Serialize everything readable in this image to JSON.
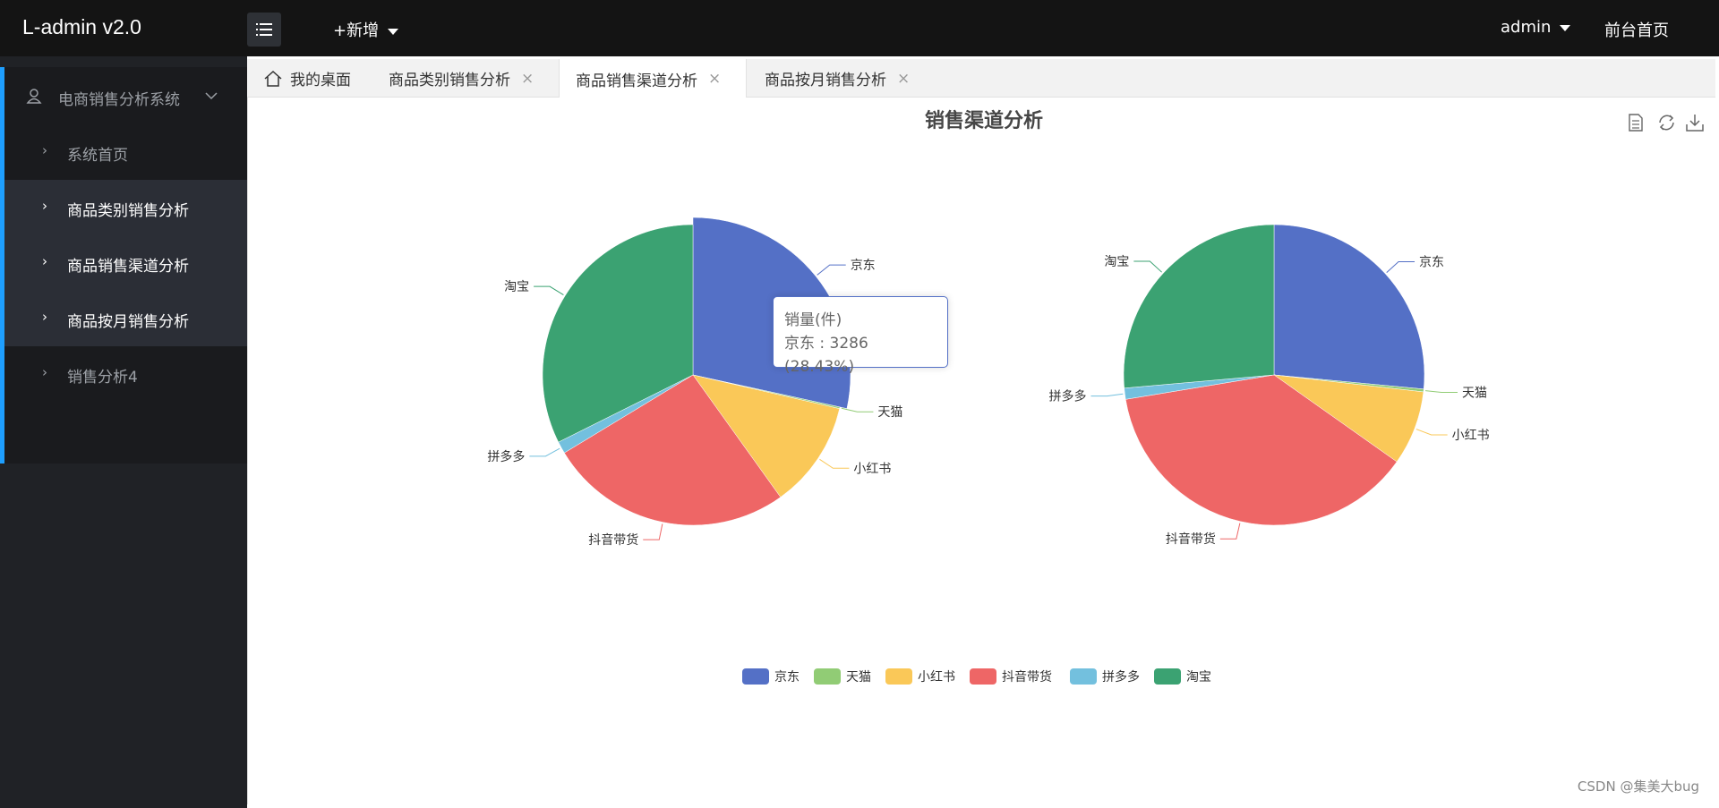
{
  "header": {
    "logo": "L-admin v2.0",
    "add_label": "+新增",
    "user_label": "admin",
    "front_link": "前台首页"
  },
  "sidebar": {
    "group_label": "电商销售分析系统",
    "items": [
      {
        "label": "系统首页"
      },
      {
        "label": "商品类别销售分析"
      },
      {
        "label": "商品销售渠道分析"
      },
      {
        "label": "商品按月销售分析"
      },
      {
        "label": "销售分析4"
      }
    ]
  },
  "tabs": [
    {
      "label": "我的桌面"
    },
    {
      "label": "商品类别销售分析",
      "close": "×"
    },
    {
      "label": "商品销售渠道分析",
      "close": "×"
    },
    {
      "label": "商品按月销售分析",
      "close": "×"
    }
  ],
  "tooltip": {
    "title": "销量(件)",
    "line": "京东 : 3286 (28.43%)"
  },
  "watermark": "CSDN @集美大bug",
  "chart_data": {
    "type": "pie",
    "title": "销售渠道分析",
    "legend_position": "bottom-center",
    "categories": [
      "京东",
      "天猫",
      "小红书",
      "抖音带货",
      "拼多多",
      "淘宝"
    ],
    "colors": [
      "#5470c6",
      "#91cc75",
      "#fac858",
      "#ee6666",
      "#73c0de",
      "#3ba272"
    ],
    "series": [
      {
        "name": "销量(件)",
        "values": [
          3286,
          20,
          1330,
          3030,
          150,
          3742
        ]
      },
      {
        "values": [
          26.5,
          0.3,
          8.0,
          37.6,
          1.2,
          26.4
        ]
      }
    ],
    "highlighted": "京东"
  }
}
